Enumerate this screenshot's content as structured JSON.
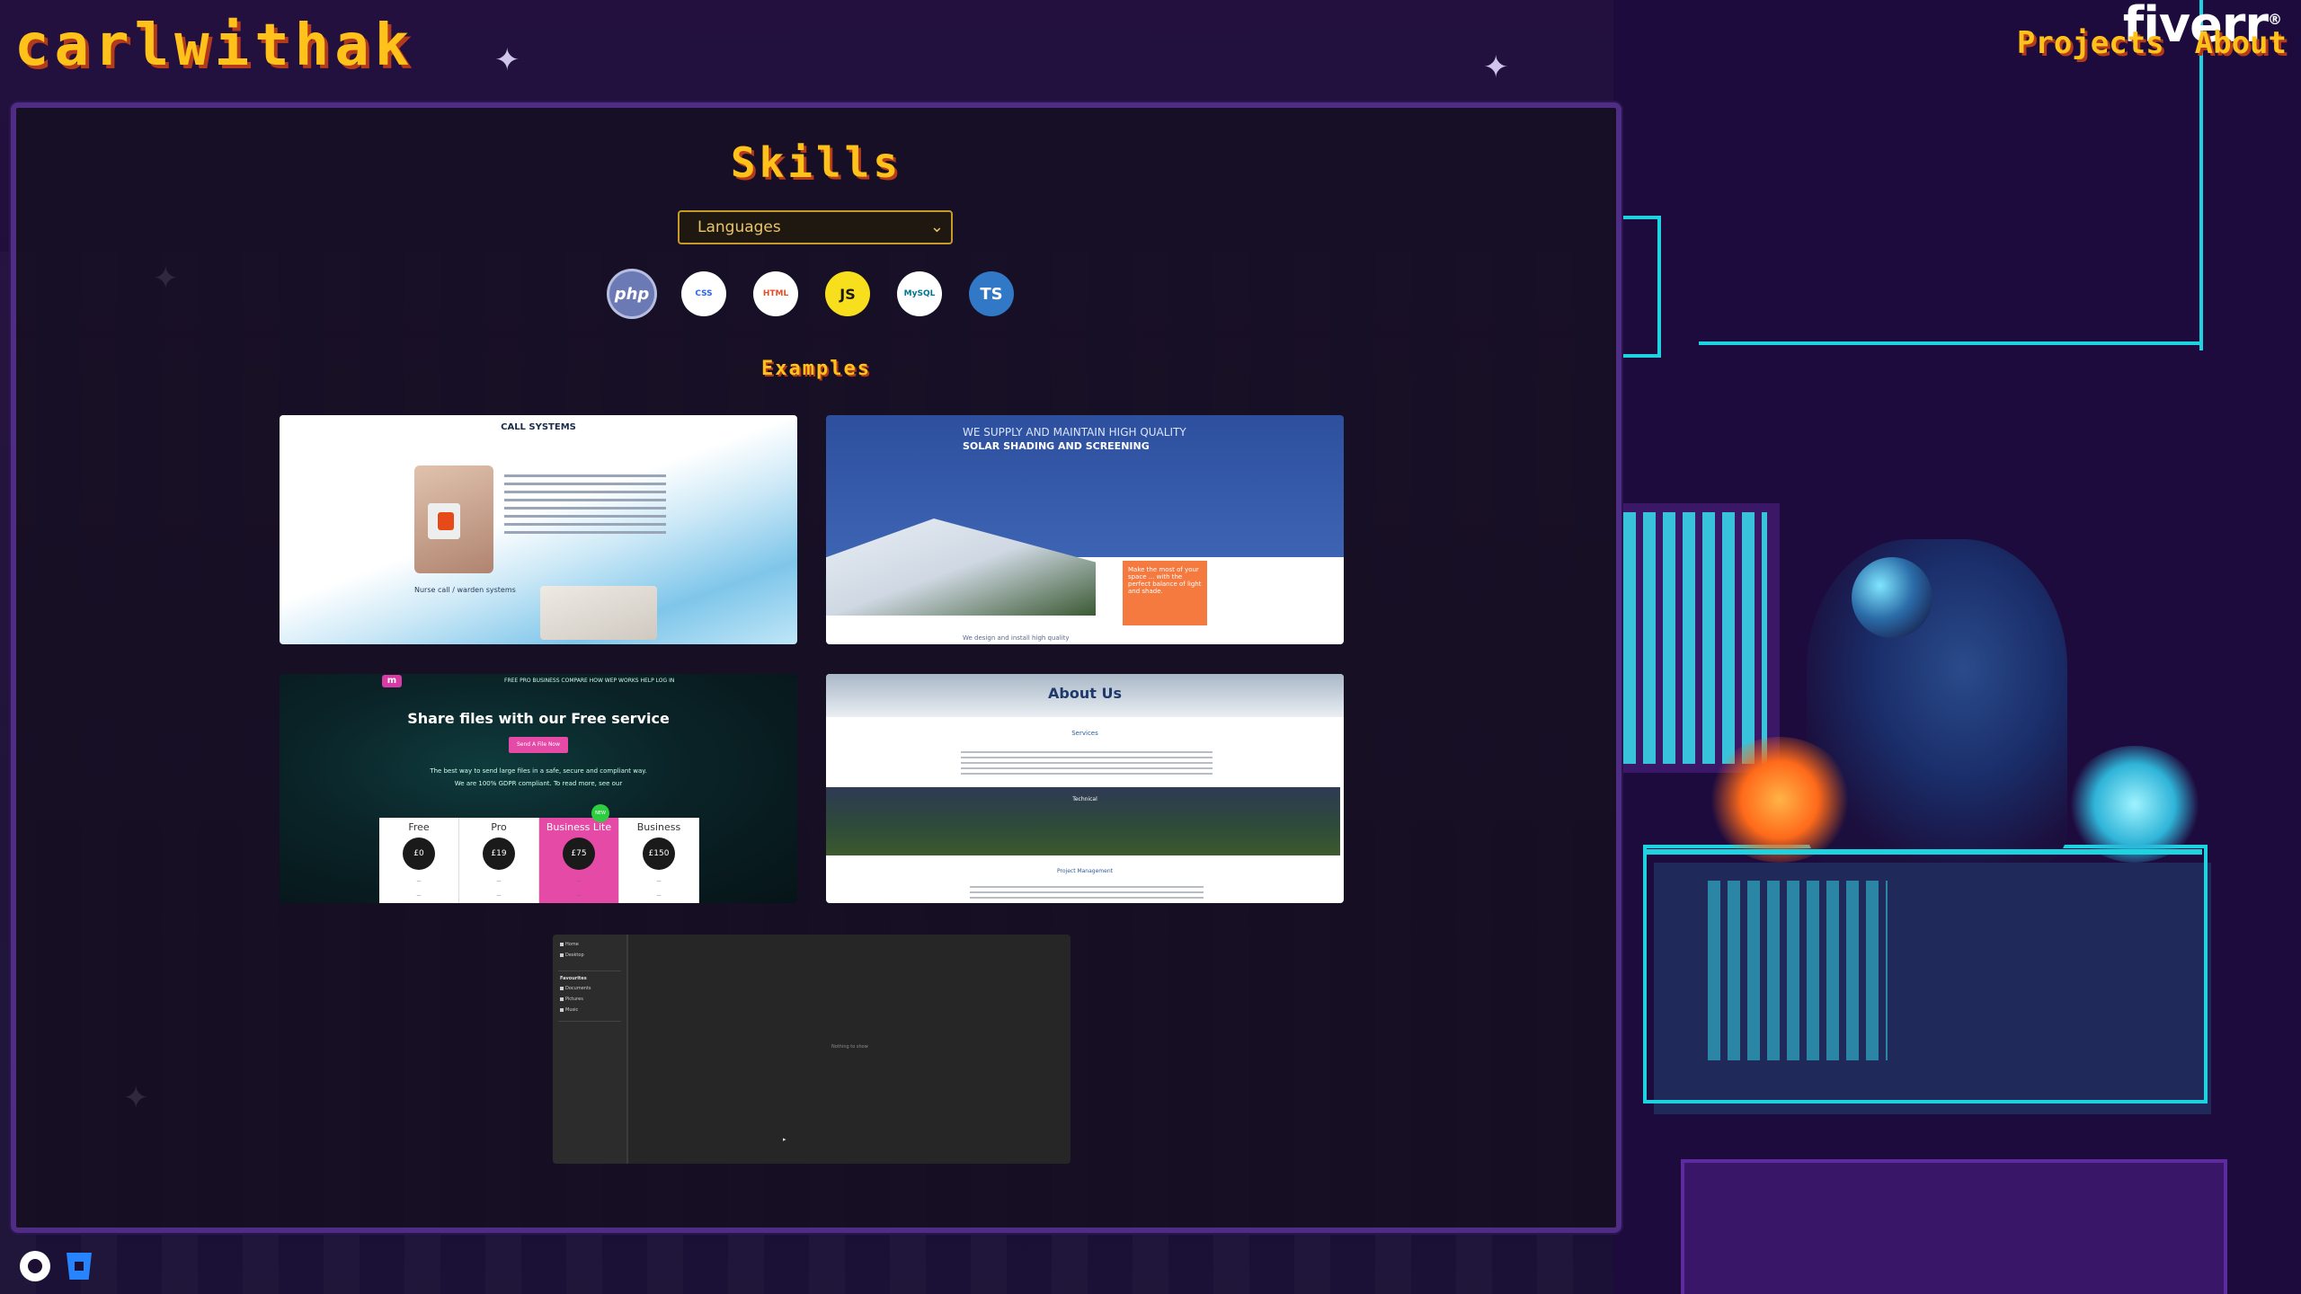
{
  "header": {
    "logo": "carlwithak",
    "nav": [
      "Projects",
      "About"
    ],
    "fiverr": "fiverr"
  },
  "skills": {
    "title": "Skills",
    "select": {
      "value": "Languages",
      "options": [
        "Languages"
      ]
    },
    "icons": [
      {
        "label": "php",
        "icon": "php-icon"
      },
      {
        "label": "CSS",
        "icon": "css3-icon"
      },
      {
        "label": "HTML",
        "icon": "html5-icon"
      },
      {
        "label": "JS",
        "icon": "javascript-icon"
      },
      {
        "label": "MySQL",
        "icon": "mysql-icon"
      },
      {
        "label": "TS",
        "icon": "typescript-icon"
      }
    ]
  },
  "examples": {
    "title": "Examples",
    "cards": [
      {
        "name": "call-systems",
        "heading": "CALL SYSTEMS",
        "subheading": "Nurse call / warden systems"
      },
      {
        "name": "solar-shading",
        "line1": "WE SUPPLY AND MAINTAIN HIGH QUALITY",
        "line2": "SOLAR SHADING AND SCREENING",
        "callout": "Make the most of your space ... with the perfect balance of light and shade.",
        "footer": "We design and install high quality"
      },
      {
        "name": "file-share",
        "headline": "Share files with our Free service",
        "cta": "Send A File Now",
        "desc": "The best way to send large files in a safe, secure and compliant way.",
        "desc2": "We are 100% GDPR compliant. To read more, see our",
        "nav": "FREE   PRO   BUSINESS   COMPARE   HOW WEP WORKS   HELP   LOG IN",
        "new_badge": "NEW",
        "tiers": [
          {
            "name": "Free",
            "price": "£0"
          },
          {
            "name": "Pro",
            "price": "£19"
          },
          {
            "name": "Business Lite",
            "price": "£75"
          },
          {
            "name": "Business",
            "price": "£150"
          }
        ]
      },
      {
        "name": "about-us",
        "title": "About Us",
        "section1": "Services",
        "section2": "Technical",
        "section3": "Project Management"
      },
      {
        "name": "file-browser",
        "favourites_label": "Favourites",
        "items": [
          "Home",
          "Desktop"
        ],
        "fav_items": [
          "Documents",
          "Pictures",
          "Music"
        ],
        "empty": "Nothing to show"
      }
    ]
  },
  "footer": {
    "icons": [
      "github-icon",
      "bitbucket-icon"
    ]
  },
  "colors": {
    "accent": "#ffc21a",
    "panel_border": "#4f2d84",
    "neon": "#1ed3e0"
  }
}
